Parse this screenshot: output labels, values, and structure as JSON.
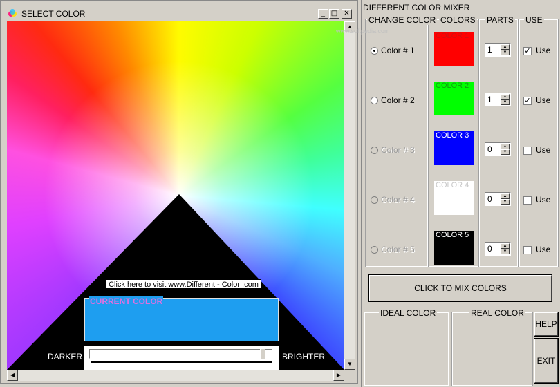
{
  "select_window": {
    "title": "SELECT COLOR",
    "visit_link": "Click here to visit   www.Different - Color .com",
    "current_color_label": "CURRENT COLOR",
    "current_color_hex": "#1e9ef0",
    "darker_label": "DARKER",
    "brighter_label": "BRIGHTER",
    "brightness_level": 0.97,
    "caption_buttons": [
      "_",
      "□",
      "✕"
    ]
  },
  "mixer_window": {
    "title": "DIFFERENT COLOR MIXER",
    "watermark": "www.softpedia.com",
    "headers": {
      "change_color": "CHANGE COLOR",
      "colors": "COLORS",
      "parts": "PARTS",
      "use": "USE"
    },
    "rows": [
      {
        "radio_label": "Color # 1",
        "selected": true,
        "enabled": true,
        "swatch_label": "COLOR 1",
        "swatch_color": "#ff0000",
        "swatch_text_color": "#d01010",
        "parts": "1",
        "use_label": "Use",
        "use_checked": true
      },
      {
        "radio_label": "Color # 2",
        "selected": false,
        "enabled": true,
        "swatch_label": "COLOR 2",
        "swatch_color": "#00ff00",
        "swatch_text_color": "#10a010",
        "parts": "1",
        "use_label": "Use",
        "use_checked": true
      },
      {
        "radio_label": "Color # 3",
        "selected": false,
        "enabled": false,
        "swatch_label": "COLOR 3",
        "swatch_color": "#0000ff",
        "swatch_text_color": "#ffffff",
        "parts": "0",
        "use_label": "Use",
        "use_checked": false
      },
      {
        "radio_label": "Color # 4",
        "selected": false,
        "enabled": false,
        "swatch_label": "COLOR 4",
        "swatch_color": "#ffffff",
        "swatch_text_color": "#c8c8c8",
        "parts": "0",
        "use_label": "Use",
        "use_checked": false
      },
      {
        "radio_label": "Color # 5",
        "selected": false,
        "enabled": false,
        "swatch_label": "COLOR 5",
        "swatch_color": "#000000",
        "swatch_text_color": "#ffffff",
        "parts": "0",
        "use_label": "Use",
        "use_checked": false
      }
    ],
    "mix_button": "CLICK TO MIX COLORS",
    "ideal_color_label": "IDEAL COLOR",
    "real_color_label": "REAL COLOR",
    "help_button": "HELP",
    "exit_button": "EXIT"
  },
  "colors": {
    "window_bg": "#d4d0c8",
    "current_color": "#1e9ef0"
  }
}
